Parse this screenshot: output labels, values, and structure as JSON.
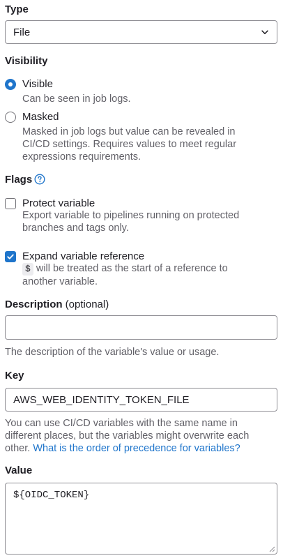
{
  "type": {
    "label": "Type",
    "selected": "File"
  },
  "visibility": {
    "label": "Visibility",
    "options": [
      {
        "title": "Visible",
        "help": "Can be seen in job logs.",
        "checked": true
      },
      {
        "title": "Masked",
        "help_lines": [
          "Masked in job logs but value can be revealed in",
          "CI/CD settings. Requires values to meet regular",
          "expressions requirements."
        ],
        "checked": false
      }
    ]
  },
  "flags": {
    "label": "Flags",
    "protect": {
      "title": "Protect variable",
      "help_lines": [
        "Export variable to pipelines running on protected",
        "branches and tags only."
      ],
      "checked": false
    },
    "expand": {
      "title": "Expand variable reference",
      "code": "$",
      "help_line1_rest": " will be treated as the start of a reference to",
      "help_line2": "another variable.",
      "checked": true
    }
  },
  "description": {
    "label": "Description",
    "optional": " (optional)",
    "value": "",
    "help": "The description of the variable's value or usage."
  },
  "key": {
    "label": "Key",
    "value": "AWS_WEB_IDENTITY_TOKEN_FILE",
    "help_lines": [
      "You can use CI/CD variables with the same name in",
      "different places, but the variables might overwrite each"
    ],
    "help_line3_text": "other. ",
    "help_link": "What is the order of precedence for variables?"
  },
  "value": {
    "label": "Value",
    "value": "${OIDC_TOKEN}"
  },
  "colors": {
    "accent": "#1f75cb",
    "text": "#1f1e24",
    "muted": "#626168",
    "border": "#8f8e94"
  }
}
